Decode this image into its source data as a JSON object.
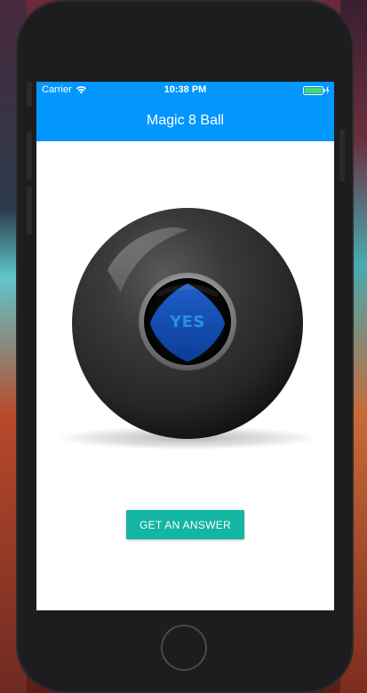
{
  "status_bar": {
    "carrier": "Carrier",
    "time": "10:38 PM",
    "wifi_icon": "wifi-icon",
    "battery_icon": "battery-charging-icon",
    "battery_color": "#4cd964"
  },
  "nav": {
    "title": "Magic 8 Ball",
    "background_color": "#0396ff"
  },
  "ball": {
    "answer": "YES",
    "answer_color": "#2a8fe6"
  },
  "actions": {
    "get_answer_label": "GET AN ANSWER",
    "button_color": "#13b5a3"
  },
  "device": {
    "home_button_icon": "home-button-ring"
  }
}
